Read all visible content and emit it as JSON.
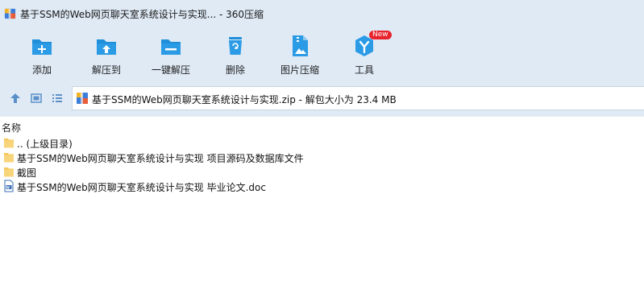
{
  "window": {
    "title": "基于SSM的Web网页聊天室系统设计与实现... - 360压缩"
  },
  "toolbar": {
    "items": [
      {
        "label": "添加",
        "icon": "add-icon"
      },
      {
        "label": "解压到",
        "icon": "extract-to-icon"
      },
      {
        "label": "一键解压",
        "icon": "one-click-extract-icon"
      },
      {
        "label": "删除",
        "icon": "delete-icon"
      },
      {
        "label": "图片压缩",
        "icon": "image-compress-icon"
      },
      {
        "label": "工具",
        "icon": "tools-icon",
        "badge": "New"
      }
    ]
  },
  "address": {
    "path_text": "基于SSM的Web网页聊天室系统设计与实现.zip - 解包大小为 23.4 MB"
  },
  "list": {
    "column_name": "名称",
    "rows": [
      {
        "name": ".. (上级目录)",
        "type": "folder"
      },
      {
        "name": "基于SSM的Web网页聊天室系统设计与实现 项目源码及数据库文件",
        "type": "folder"
      },
      {
        "name": "截图",
        "type": "folder"
      },
      {
        "name": "基于SSM的Web网页聊天室系统设计与实现 毕业论文.doc",
        "type": "doc"
      }
    ]
  },
  "colors": {
    "chrome_bg": "#dfeaf5",
    "icon_blue": "#1e8fd8",
    "folder_yellow": "#f5c75b",
    "badge_red": "#e8232d"
  }
}
